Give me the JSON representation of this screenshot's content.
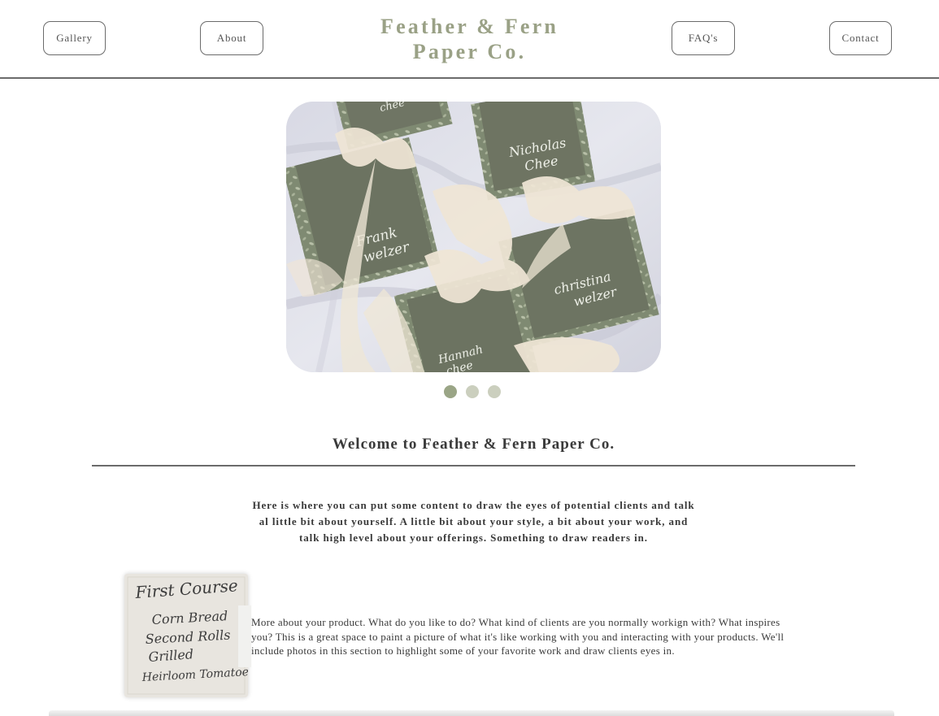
{
  "nav": {
    "gallery": "Gallery",
    "about": "About",
    "faq": "FAQ's",
    "contact": "Contact"
  },
  "brand": {
    "line1": "Feather & Fern",
    "line2": "Paper Co.",
    "color": "#9aa186"
  },
  "hero": {
    "image": "place-cards-with-ribbons",
    "card_names": [
      "Nicholas Chee",
      "Frank Welzer",
      "Christina Welzer",
      "Hannah Chee",
      "Chee"
    ],
    "slides": 3,
    "active_slide": 1
  },
  "welcome": {
    "title": "Welcome to Feather & Fern Paper Co.",
    "intro": "Here is where you can put some content to draw the eyes of potential clients and talk al little bit about yourself. A little bit about your style, a bit about your work, and talk high level about your offerings. Something to draw readers in."
  },
  "menu_card": {
    "lines": [
      "First Course",
      "Corn Bread",
      "Second Rolls",
      "Grilled",
      "Heirloom Tomatoes"
    ]
  },
  "about": {
    "text": "More about your product. What do you like to do? What kind of clients are you normally workign with? What inspires you? This is a great space to paint a picture of what it's like working with you and interacting with your products. We'll include photos in this section to highlight some of your favorite work and draw clients eyes in."
  },
  "colors": {
    "accent": "#9aa586",
    "dot_inactive": "#cbcfbe",
    "rule": "#6b6b6b"
  }
}
